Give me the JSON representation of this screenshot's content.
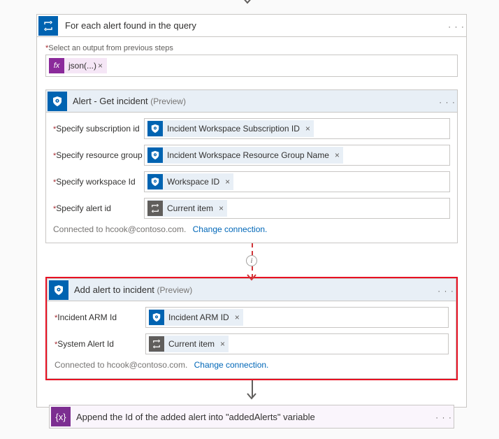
{
  "foreach": {
    "title": "For each alert found in the query",
    "select_label": "Select an output from previous steps",
    "fx_token": "json(...)"
  },
  "alert_incident": {
    "title": "Alert - Get incident ",
    "preview": "(Preview)",
    "rows": {
      "sub": {
        "label": "Specify subscription id",
        "pill": "Incident Workspace Subscription ID"
      },
      "rg": {
        "label": "Specify resource group",
        "pill": "Incident Workspace Resource Group Name"
      },
      "ws": {
        "label": "Specify workspace Id",
        "pill": "Workspace ID"
      },
      "al": {
        "label": "Specify alert id",
        "pill": "Current item"
      }
    },
    "connected": "Connected to hcook@contoso.com.",
    "change": "Change connection."
  },
  "add_alert": {
    "title": "Add alert to incident ",
    "preview": "(Preview)",
    "rows": {
      "arm": {
        "label": "Incident ARM Id",
        "pill": "Incident ARM ID"
      },
      "sys": {
        "label": "System Alert Id",
        "pill": "Current item"
      }
    },
    "connected": "Connected to hcook@contoso.com.",
    "change": "Change connection."
  },
  "append": {
    "title": "Append the Id of the added alert into \"addedAlerts\" variable"
  },
  "glyphs": {
    "x": "×",
    "dots": "· · ·"
  }
}
